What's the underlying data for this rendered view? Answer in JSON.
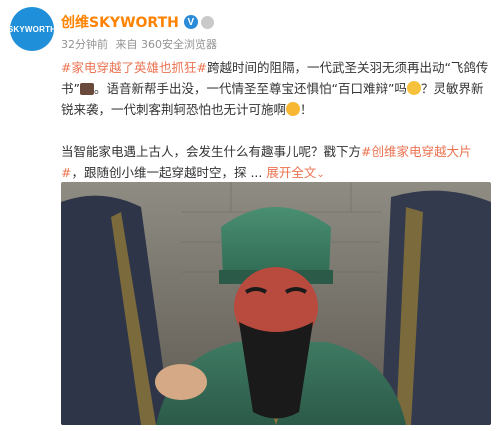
{
  "account": {
    "name": "创维SKYWORTH",
    "avatar_text": "SKYWORTH"
  },
  "meta": {
    "time": "32分钟前",
    "source": "来自 360安全浏览器"
  },
  "post": {
    "tag1": "#家电穿越了英雄也抓狂#",
    "line1": "跨越时间的阻隔，一代武圣关羽无须再出动“飞鸽传书”",
    "line2": "。语音新帮手出没，一代情圣至尊宝还惧怕“百口难辩”吗",
    "line3": "？灵敏界新锐来袭，一代刺客荆轲恐怕也无计可施啊",
    "line3_end": "！",
    "para2_text": "当智能家电遇上古人，会发生什么有趣事儿呢？戳下方",
    "tag2": "#创维家电穿越大片#",
    "para2_text2": "，跟随创小维一起穿越时空，探 ...",
    "expand": "展开全文",
    "expand_icon": "chevron-down"
  },
  "colors": {
    "brand_orange": "#ff8200",
    "link": "#eb7350",
    "avatar_blue": "#1e8fd8"
  }
}
